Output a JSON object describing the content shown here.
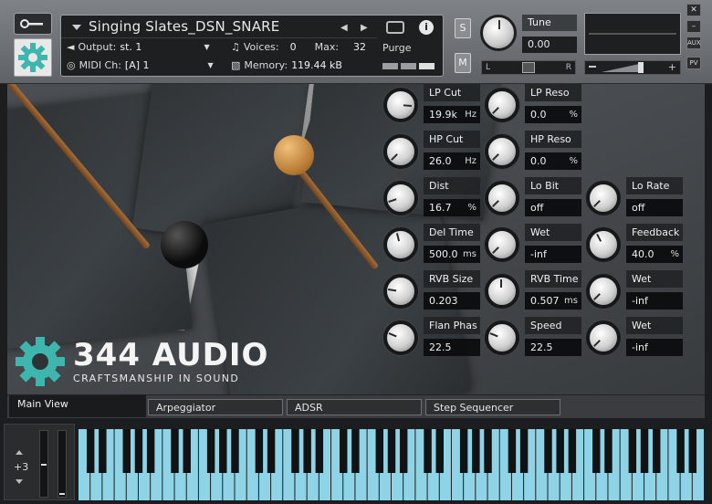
{
  "header": {
    "instrument_name": "Singing Slates_DSN_SNARE",
    "output_label": "Output:",
    "output_value": "st. 1",
    "voices_label": "Voices:",
    "voices_value": "0",
    "max_label": "Max:",
    "max_value": "32",
    "midi_label": "MIDI Ch:",
    "midi_value": "[A]  1",
    "memory_label": "Memory:",
    "memory_value": "119.44 kB",
    "purge_label": "Purge",
    "solo_label": "S",
    "mute_label": "M",
    "tune_label": "Tune",
    "tune_value": "0.00",
    "pan_left": "L",
    "pan_right": "R",
    "aux_label": "AUX",
    "pv_label": "PV"
  },
  "brand": {
    "name": "344 AUDIO",
    "tagline": "CRAFTSMANSHIP IN SOUND",
    "accent": "#3fb6ad"
  },
  "controls": [
    {
      "label": "LP Cut",
      "value": "19.9k",
      "unit": "Hz",
      "level": 0.85
    },
    {
      "label": "LP Reso",
      "value": "0.0",
      "unit": "%",
      "level": 0.0
    },
    {
      "label": "HP Cut",
      "value": "26.0",
      "unit": "Hz",
      "level": 0.0
    },
    {
      "label": "HP Reso",
      "value": "0.0",
      "unit": "%",
      "level": 0.0
    },
    {
      "label": "Dist",
      "value": "16.7",
      "unit": "%",
      "level": 0.1
    },
    {
      "label": "Lo Bit",
      "value": "off",
      "unit": "",
      "level": 0.0
    },
    {
      "label": "Lo Rate",
      "value": "off",
      "unit": "",
      "level": 0.0
    },
    {
      "label": "Del Time",
      "value": "500.0",
      "unit": "ms",
      "level": 0.45
    },
    {
      "label": "Wet",
      "value": "-inf",
      "unit": "",
      "level": 0.0
    },
    {
      "label": "Feedback",
      "value": "40.0",
      "unit": "%",
      "level": 0.4
    },
    {
      "label": "RVB Size",
      "value": "0.203",
      "unit": "",
      "level": 0.2
    },
    {
      "label": "RVB Time",
      "value": "0.507",
      "unit": "ms",
      "level": 0.5
    },
    {
      "label": "Wet",
      "value": "-inf",
      "unit": "",
      "level": 0.0
    },
    {
      "label": "Flan Phas",
      "value": "22.5",
      "unit": "",
      "level": 0.25
    },
    {
      "label": "Speed",
      "value": "22.5",
      "unit": "",
      "level": 0.25
    },
    {
      "label": "Wet",
      "value": "-inf",
      "unit": "",
      "level": 0.0
    }
  ],
  "tabs": [
    {
      "label": "Main View",
      "active": true
    },
    {
      "label": "Arpeggiator",
      "active": false
    },
    {
      "label": "ADSR",
      "active": false
    },
    {
      "label": "Step Sequencer",
      "active": false
    }
  ],
  "keyboard": {
    "octave_label": "+3",
    "key_color": "#8fd3e6",
    "black_key_color": "#101214"
  }
}
